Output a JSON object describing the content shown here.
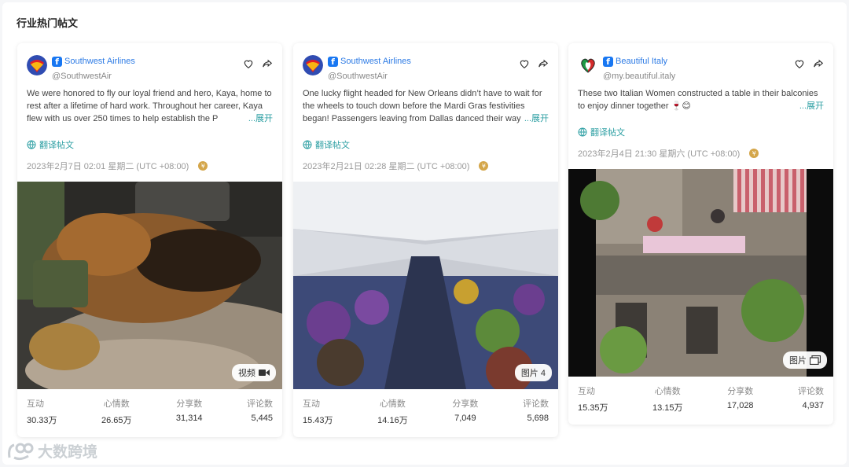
{
  "section_title": "行业热门帖文",
  "watermark": "大数跨境",
  "labels": {
    "translate": "翻译帖文",
    "expand": "...展开",
    "coin_glyph": "¥"
  },
  "stat_labels": [
    "互动",
    "心情数",
    "分享数",
    "评论数"
  ],
  "posts": [
    {
      "account_name": "Southwest Airlines",
      "handle": "@SouthwestAir",
      "text": "We were honored to fly our loyal friend and hero, Kaya, home to rest after a lifetime of hard work. Throughout her career, Kaya flew with us over 250 times to help establish the P",
      "date": "2023年2月7日 02:01 星期二 (UTC +08:00)",
      "media_badge": "视频",
      "media_icon": "video-icon",
      "stats": [
        "30.33万",
        "26.65万",
        "31,314",
        "5,445"
      ]
    },
    {
      "account_name": "Southwest Airlines",
      "handle": "@SouthwestAir",
      "text": "One lucky flight headed for New Orleans didn’t have to wait for the wheels to touch down before the Mardi Gras festivities began! Passengers leaving from Dallas danced their way",
      "date": "2023年2月21日 02:28 星期二 (UTC +08:00)",
      "media_badge": "图片 4",
      "media_icon": "",
      "stats": [
        "15.43万",
        "14.16万",
        "7,049",
        "5,698"
      ]
    },
    {
      "account_name": "Beautiful Italy",
      "handle": "@my.beautiful.italy",
      "text": "These two Italian Women constructed a table in their balconies to enjoy dinner together 🍷😊",
      "date": "2023年2月4日 21:30 星期六 (UTC +08:00)",
      "media_badge": "图片",
      "media_icon": "gallery-icon",
      "stats": [
        "15.35万",
        "13.15万",
        "17,028",
        "4,937"
      ]
    }
  ]
}
